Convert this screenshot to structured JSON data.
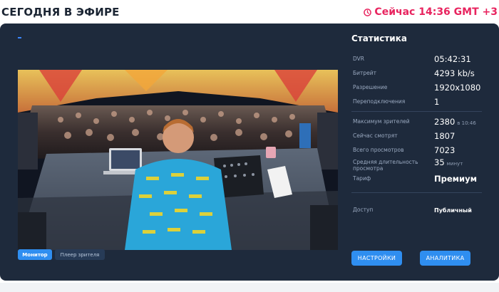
{
  "header": {
    "title": "СЕГОДНЯ В ЭФИРЕ",
    "clock_text": "Сейчас 14:36 GMT +3",
    "clock_icon": "clock-icon",
    "accent_color": "#e8245f"
  },
  "tabs": {
    "monitor": "Монитор",
    "player": "Плеер зрителя"
  },
  "stats": {
    "title": "Статистика",
    "dvr_label": "DVR",
    "dvr_value": "05:42:31",
    "bitrate_label": "Битрейт",
    "bitrate_value": "4293 kb/s",
    "resolution_label": "Разрешение",
    "resolution_value": "1920x1080",
    "reconnects_label": "Переподключения",
    "reconnects_value": "1",
    "max_viewers_label": "Максимум зрителей",
    "max_viewers_value": "2380",
    "max_viewers_time": "в 10:46",
    "watching_now_label": "Сейчас смотрят",
    "watching_now_value": "1807",
    "total_views_label": "Всего просмотров",
    "total_views_value": "7023",
    "avg_duration_label": "Средняя длительность просмотра",
    "avg_duration_value": "35",
    "avg_duration_unit": "минут",
    "tariff_label": "Тариф",
    "tariff_value": "Премиум",
    "access_label": "Доступ",
    "access_value": "Публичный"
  },
  "buttons": {
    "settings": "НАСТРОЙКИ",
    "analytics": "АНАЛИТИКА",
    "primary_color": "#2f8ef0"
  }
}
